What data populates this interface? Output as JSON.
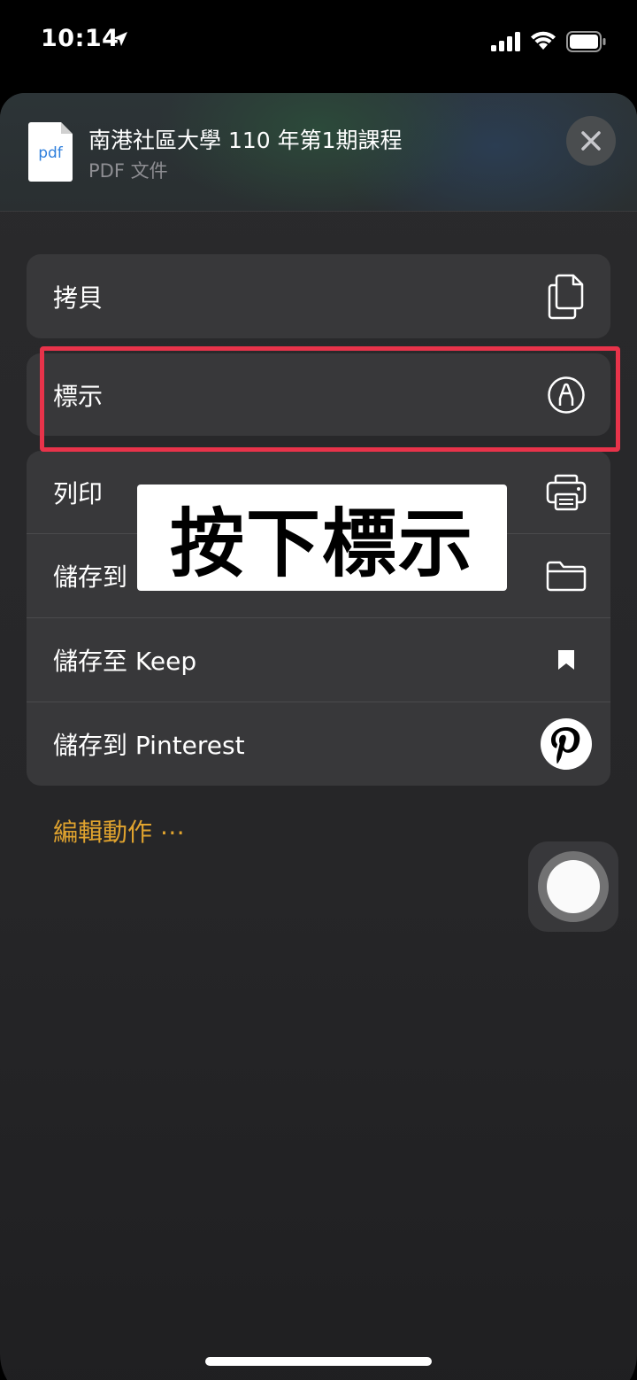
{
  "status_bar": {
    "time": "10:14",
    "icons": [
      "location-arrow-icon",
      "cellular-signal-icon",
      "wifi-icon",
      "battery-icon"
    ]
  },
  "share_sheet": {
    "document": {
      "thumbnail_label": "pdf",
      "title": "南港社區大學 110 年第1期課程",
      "subtitle": "PDF 文件"
    },
    "close_icon": "close-icon",
    "actions_group_1": [
      {
        "label": "拷貝",
        "icon": "copy-icon"
      }
    ],
    "actions_group_2": [
      {
        "label": "標示",
        "icon": "markup-icon"
      }
    ],
    "actions_group_3": [
      {
        "label": "列印",
        "icon": "printer-icon"
      },
      {
        "label": "儲存到",
        "icon": "folder-icon"
      },
      {
        "label": "儲存至 Keep",
        "icon": "bookmark-icon"
      },
      {
        "label": "儲存到 Pinterest",
        "icon": "pinterest-icon"
      }
    ],
    "edit_actions_label": "編輯動作 ⋯"
  },
  "annotation": {
    "instruction_text": "按下標示",
    "highlight_color": "#e8334a"
  },
  "colors": {
    "accent": "#e0a32e",
    "row_background": "#38383a",
    "sheet_background": "#2a2a2c"
  }
}
